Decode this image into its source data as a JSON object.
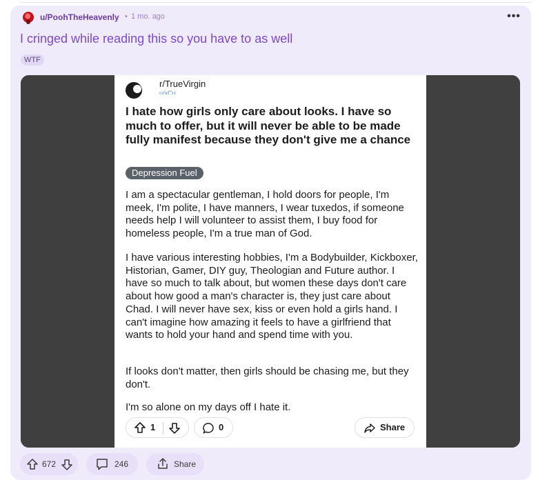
{
  "post": {
    "username": "u/PoohTheHeavenly",
    "meta_dot": "•",
    "time": "1 mo. ago",
    "more": "•••",
    "title": "I cringed while reading this so you have to as well",
    "flair": "WTF",
    "actions": {
      "upvotes": "672",
      "comments": "246",
      "share": "Share"
    }
  },
  "screenshot": {
    "subreddit": "r/TrueVirgin",
    "user": "u/xCu...",
    "title": "I hate how girls only care about looks. I have so much to offer, but it will never be able to be made fully manifest because they don't give me a chance",
    "flair": "Depression Fuel",
    "paragraphs": [
      "I am a spectacular gentleman, I hold doors for people, I'm meek, I'm polite, I have manners, I wear tuxedos, if someone needs help I will volunteer to assist them, I buy food for homeless people, I'm a true man of God.",
      "I have various interesting hobbies, I'm a Bodybuilder, Kickboxer, Historian, Gamer, DIY guy, Theologian and Future author. I have so much to talk about, but women these days don't care about how good a man's character is, they just care about Chad. I will never have sex, kiss or even hold a girls hand. I can't imagine how amazing it feels to have a girlfriend that wants to hold your hand and spend time with you.",
      "If looks don't matter, then girls should be chasing me, but they don't.",
      "I'm so alone on my days off I hate it."
    ],
    "votes": "1",
    "comments": "0",
    "share": "Share"
  },
  "colors": {
    "card_bg": "#f0ebfa",
    "accent": "#7b49c4",
    "button_bg": "#e8e0f8"
  }
}
